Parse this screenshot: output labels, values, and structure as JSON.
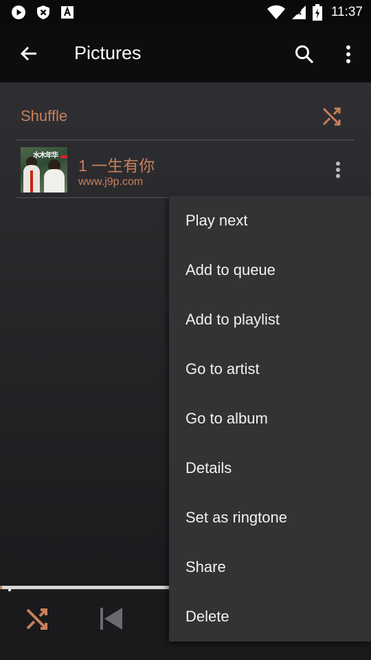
{
  "status_bar": {
    "time": "11:37",
    "left_icons": [
      "play-notification-icon",
      "shield-icon",
      "font-icon"
    ],
    "right_icons": [
      "wifi-icon",
      "signal-icon",
      "battery-icon"
    ]
  },
  "toolbar": {
    "title": "Pictures",
    "back_icon": "arrow-left-icon",
    "search_icon": "search-icon",
    "more_icon": "more-vert-icon"
  },
  "list": {
    "shuffle_label": "Shuffle",
    "songs": [
      {
        "title": "1 一生有你",
        "subtitle": "www.j9p.com",
        "art_text": "水木年华"
      }
    ]
  },
  "player": {
    "progress_fraction": 0.005,
    "buttons": [
      "shuffle-icon",
      "skip-previous-icon"
    ]
  },
  "context_menu": {
    "items": [
      "Play next",
      "Add to queue",
      "Add to playlist",
      "Go to artist",
      "Go to album",
      "Details",
      "Set as ringtone",
      "Share",
      "Delete"
    ]
  },
  "colors": {
    "accent": "#c9805a",
    "toolbar_bg": "#0d0d0d",
    "menu_bg": "#333336"
  }
}
